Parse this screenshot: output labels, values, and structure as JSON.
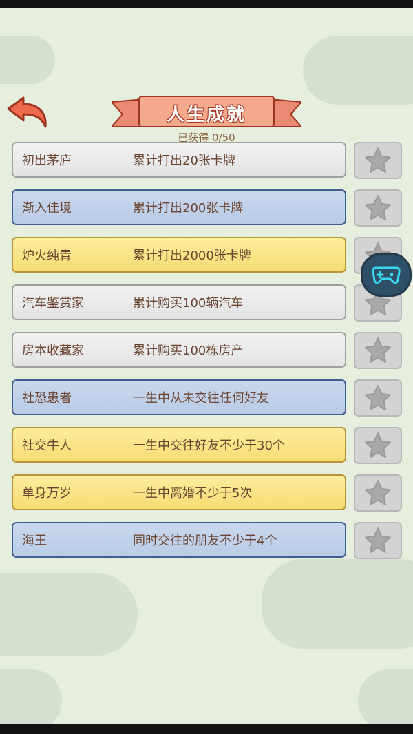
{
  "header": {
    "title": "人生成就",
    "progress_text": "已获得 0/50",
    "back_icon": "back-arrow-icon"
  },
  "achievements": [
    {
      "name": "初出茅庐",
      "description": "累计打出20张卡牌",
      "style": "gray"
    },
    {
      "name": "渐入佳境",
      "description": "累计打出200张卡牌",
      "style": "blue"
    },
    {
      "name": "炉火纯青",
      "description": "累计打出2000张卡牌",
      "style": "yellow"
    },
    {
      "name": "汽车鉴赏家",
      "description": "累计购买100辆汽车",
      "style": "gray"
    },
    {
      "name": "房本收藏家",
      "description": "累计购买100栋房产",
      "style": "gray"
    },
    {
      "name": "社恐患者",
      "description": "一生中从未交往任何好友",
      "style": "blue"
    },
    {
      "name": "社交牛人",
      "description": "一生中交往好友不少于30个",
      "style": "yellow"
    },
    {
      "name": "单身万岁",
      "description": "一生中离婚不少于5次",
      "style": "yellow"
    },
    {
      "name": "海王",
      "description": "同时交往的朋友不少于4个",
      "style": "blue"
    }
  ],
  "floating": {
    "icon": "gamepad-icon"
  },
  "colors": {
    "background": "#e6eedd",
    "ribbon": "#f0a88c",
    "text": "#6a4430",
    "star": "#a9a9a9"
  }
}
